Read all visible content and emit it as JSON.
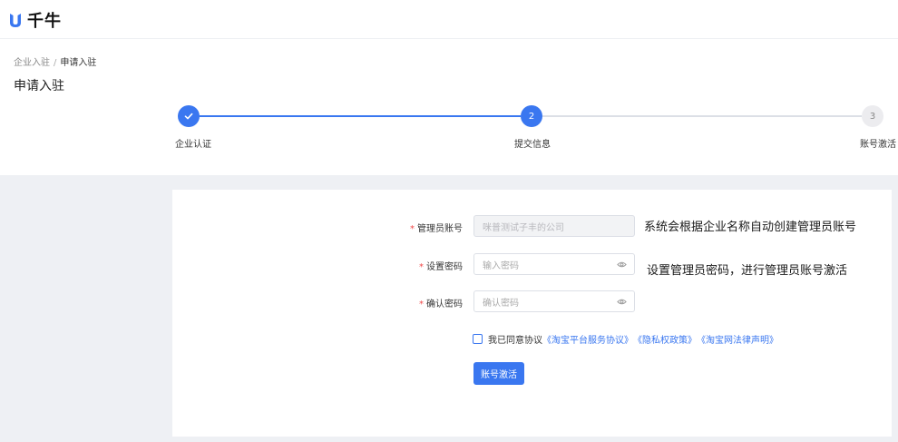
{
  "app": {
    "logo_text": "千牛"
  },
  "breadcrumb": {
    "parent": "企业入驻",
    "separator": "/",
    "current": "申请入驻"
  },
  "page_title": "申请入驻",
  "steps": [
    {
      "number": "1",
      "label": "企业认证",
      "state": "done"
    },
    {
      "number": "2",
      "label": "提交信息",
      "state": "active"
    },
    {
      "number": "3",
      "label": "账号激活",
      "state": "todo"
    }
  ],
  "colors": {
    "primary": "#3a77f0",
    "required": "#f04848",
    "page_bg": "#eef0f4",
    "step_todo": "#ececef"
  },
  "form": {
    "admin_account": {
      "required_mark": "*",
      "label": "管理员账号",
      "value": "咪普测试子丰的公司"
    },
    "password": {
      "required_mark": "*",
      "label": "设置密码",
      "placeholder": "输入密码"
    },
    "confirm_password": {
      "required_mark": "*",
      "label": "确认密码",
      "placeholder": "确认密码"
    },
    "agreement": {
      "prefix": "我已同意协议",
      "links": [
        "《淘宝平台服务协议》",
        "《隐私权政策》",
        "《淘宝网法律声明》"
      ]
    },
    "submit_label": "账号激活"
  },
  "notes": {
    "account_note": "系统会根据企业名称自动创建管理员账号",
    "password_note": "设置管理员密码，进行管理员账号激活"
  }
}
